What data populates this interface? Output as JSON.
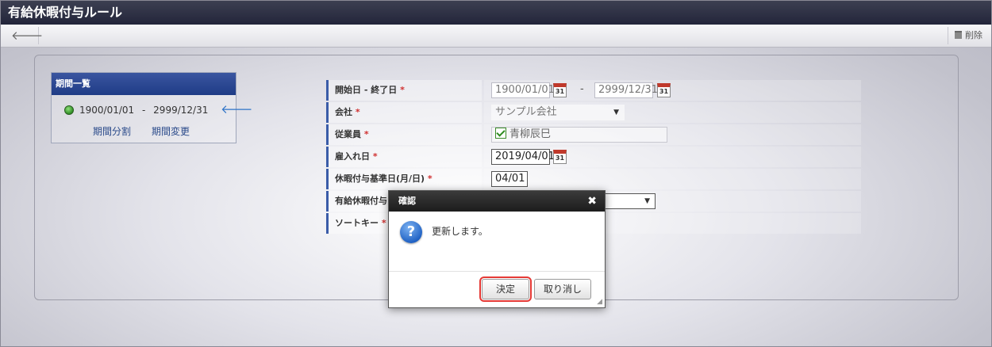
{
  "app": {
    "title": "有給休暇付与ルール"
  },
  "toolbar": {
    "back_icon": "back-arrow-icon",
    "delete_label": "削除"
  },
  "period_list": {
    "title": "期間一覧",
    "start": "1900/01/01",
    "separator": "-",
    "end": "2999/12/31",
    "split_link": "期間分割",
    "change_link": "期間変更"
  },
  "form": {
    "start_end": {
      "label": "開始日 - 終了日",
      "start": "1900/01/01",
      "separator": "-",
      "end": "2999/12/31"
    },
    "company": {
      "label": "会社",
      "value": "サンプル会社"
    },
    "employee": {
      "label": "従業員",
      "value": "青柳辰巳"
    },
    "hire_date": {
      "label": "雇入れ日",
      "value": "2019/04/01"
    },
    "base_date": {
      "label": "休暇付与基準日(月/日)",
      "value": "04/01"
    },
    "paid_leave": {
      "label": "有給休暇付与"
    },
    "sort_key": {
      "label": "ソートキー"
    },
    "required_mark": "*",
    "calendar_day": "31"
  },
  "dialog": {
    "title": "確認",
    "close_symbol": "✖",
    "message": "更新します。",
    "ok_label": "決定",
    "cancel_label": "取り消し"
  },
  "colors": {
    "header_dark": "#23253a",
    "panel_header": "#1f3c86",
    "highlight": "#e53935"
  }
}
